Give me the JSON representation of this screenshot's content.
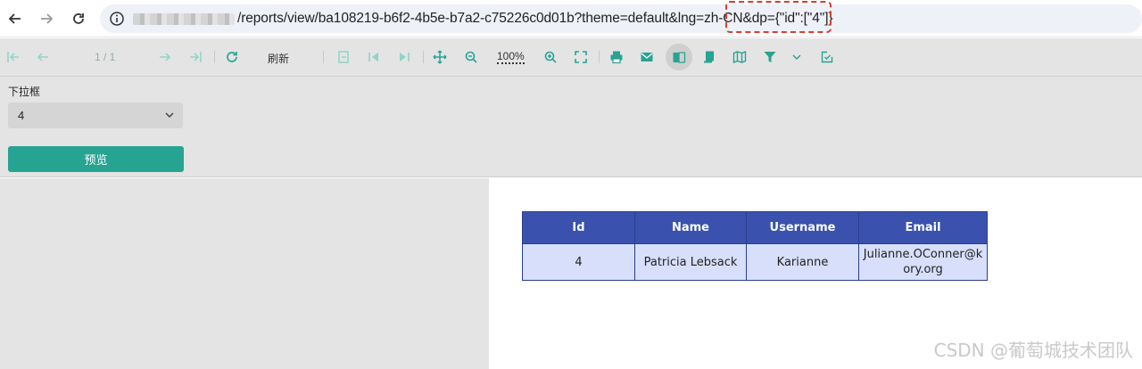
{
  "browser": {
    "url_path": "/reports/view/ba108219-b6f2-4b5e-b7a2-c75226c0d01b?theme=default&lng=zh-CN&dp={\"id\":[\"4\"]}"
  },
  "toolbar": {
    "page_indicator": "1 / 1",
    "refresh_label": "刷新",
    "zoom_level": "100%"
  },
  "params": {
    "dropdown_label": "下拉框",
    "dropdown_value": "4",
    "preview_label": "预览"
  },
  "report": {
    "headers": [
      "Id",
      "Name",
      "Username",
      "Email"
    ],
    "row": [
      "4",
      "Patricia Lebsack",
      "Karianne",
      "Julianne.OConner@kory.org"
    ]
  },
  "watermark": "CSDN @葡萄城技术团队",
  "colors": {
    "accent": "#27a391",
    "table_header": "#3a52ad",
    "table_cell": "#d7dffa",
    "highlight": "#d5402c"
  }
}
